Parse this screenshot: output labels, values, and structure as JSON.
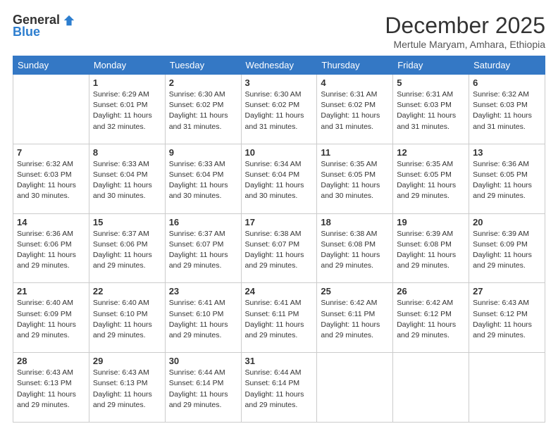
{
  "logo": {
    "general": "General",
    "blue": "Blue"
  },
  "header": {
    "month": "December 2025",
    "location": "Mertule Maryam, Amhara, Ethiopia"
  },
  "weekdays": [
    "Sunday",
    "Monday",
    "Tuesday",
    "Wednesday",
    "Thursday",
    "Friday",
    "Saturday"
  ],
  "weeks": [
    [
      {
        "day": "",
        "info": ""
      },
      {
        "day": "1",
        "info": "Sunrise: 6:29 AM\nSunset: 6:01 PM\nDaylight: 11 hours\nand 32 minutes."
      },
      {
        "day": "2",
        "info": "Sunrise: 6:30 AM\nSunset: 6:02 PM\nDaylight: 11 hours\nand 31 minutes."
      },
      {
        "day": "3",
        "info": "Sunrise: 6:30 AM\nSunset: 6:02 PM\nDaylight: 11 hours\nand 31 minutes."
      },
      {
        "day": "4",
        "info": "Sunrise: 6:31 AM\nSunset: 6:02 PM\nDaylight: 11 hours\nand 31 minutes."
      },
      {
        "day": "5",
        "info": "Sunrise: 6:31 AM\nSunset: 6:03 PM\nDaylight: 11 hours\nand 31 minutes."
      },
      {
        "day": "6",
        "info": "Sunrise: 6:32 AM\nSunset: 6:03 PM\nDaylight: 11 hours\nand 31 minutes."
      }
    ],
    [
      {
        "day": "7",
        "info": "Sunrise: 6:32 AM\nSunset: 6:03 PM\nDaylight: 11 hours\nand 30 minutes."
      },
      {
        "day": "8",
        "info": "Sunrise: 6:33 AM\nSunset: 6:04 PM\nDaylight: 11 hours\nand 30 minutes."
      },
      {
        "day": "9",
        "info": "Sunrise: 6:33 AM\nSunset: 6:04 PM\nDaylight: 11 hours\nand 30 minutes."
      },
      {
        "day": "10",
        "info": "Sunrise: 6:34 AM\nSunset: 6:04 PM\nDaylight: 11 hours\nand 30 minutes."
      },
      {
        "day": "11",
        "info": "Sunrise: 6:35 AM\nSunset: 6:05 PM\nDaylight: 11 hours\nand 30 minutes."
      },
      {
        "day": "12",
        "info": "Sunrise: 6:35 AM\nSunset: 6:05 PM\nDaylight: 11 hours\nand 29 minutes."
      },
      {
        "day": "13",
        "info": "Sunrise: 6:36 AM\nSunset: 6:05 PM\nDaylight: 11 hours\nand 29 minutes."
      }
    ],
    [
      {
        "day": "14",
        "info": "Sunrise: 6:36 AM\nSunset: 6:06 PM\nDaylight: 11 hours\nand 29 minutes."
      },
      {
        "day": "15",
        "info": "Sunrise: 6:37 AM\nSunset: 6:06 PM\nDaylight: 11 hours\nand 29 minutes."
      },
      {
        "day": "16",
        "info": "Sunrise: 6:37 AM\nSunset: 6:07 PM\nDaylight: 11 hours\nand 29 minutes."
      },
      {
        "day": "17",
        "info": "Sunrise: 6:38 AM\nSunset: 6:07 PM\nDaylight: 11 hours\nand 29 minutes."
      },
      {
        "day": "18",
        "info": "Sunrise: 6:38 AM\nSunset: 6:08 PM\nDaylight: 11 hours\nand 29 minutes."
      },
      {
        "day": "19",
        "info": "Sunrise: 6:39 AM\nSunset: 6:08 PM\nDaylight: 11 hours\nand 29 minutes."
      },
      {
        "day": "20",
        "info": "Sunrise: 6:39 AM\nSunset: 6:09 PM\nDaylight: 11 hours\nand 29 minutes."
      }
    ],
    [
      {
        "day": "21",
        "info": "Sunrise: 6:40 AM\nSunset: 6:09 PM\nDaylight: 11 hours\nand 29 minutes."
      },
      {
        "day": "22",
        "info": "Sunrise: 6:40 AM\nSunset: 6:10 PM\nDaylight: 11 hours\nand 29 minutes."
      },
      {
        "day": "23",
        "info": "Sunrise: 6:41 AM\nSunset: 6:10 PM\nDaylight: 11 hours\nand 29 minutes."
      },
      {
        "day": "24",
        "info": "Sunrise: 6:41 AM\nSunset: 6:11 PM\nDaylight: 11 hours\nand 29 minutes."
      },
      {
        "day": "25",
        "info": "Sunrise: 6:42 AM\nSunset: 6:11 PM\nDaylight: 11 hours\nand 29 minutes."
      },
      {
        "day": "26",
        "info": "Sunrise: 6:42 AM\nSunset: 6:12 PM\nDaylight: 11 hours\nand 29 minutes."
      },
      {
        "day": "27",
        "info": "Sunrise: 6:43 AM\nSunset: 6:12 PM\nDaylight: 11 hours\nand 29 minutes."
      }
    ],
    [
      {
        "day": "28",
        "info": "Sunrise: 6:43 AM\nSunset: 6:13 PM\nDaylight: 11 hours\nand 29 minutes."
      },
      {
        "day": "29",
        "info": "Sunrise: 6:43 AM\nSunset: 6:13 PM\nDaylight: 11 hours\nand 29 minutes."
      },
      {
        "day": "30",
        "info": "Sunrise: 6:44 AM\nSunset: 6:14 PM\nDaylight: 11 hours\nand 29 minutes."
      },
      {
        "day": "31",
        "info": "Sunrise: 6:44 AM\nSunset: 6:14 PM\nDaylight: 11 hours\nand 29 minutes."
      },
      {
        "day": "",
        "info": ""
      },
      {
        "day": "",
        "info": ""
      },
      {
        "day": "",
        "info": ""
      }
    ]
  ]
}
